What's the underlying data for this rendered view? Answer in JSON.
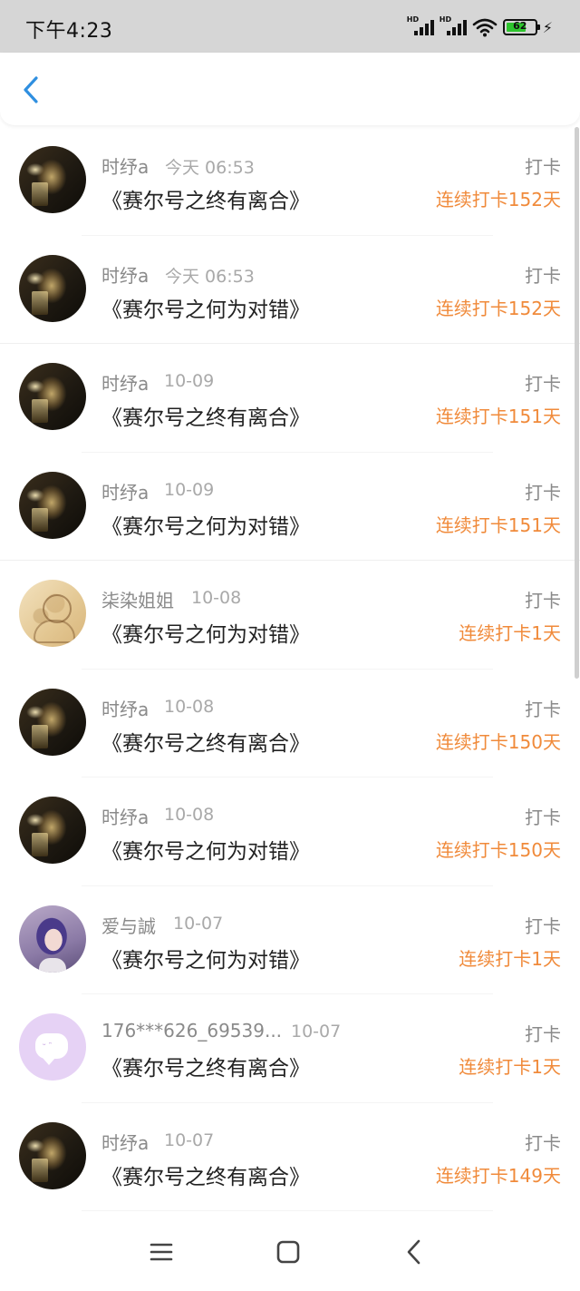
{
  "status_bar": {
    "time": "下午4:23",
    "network_label_1": "HD",
    "network_label_2": "HD",
    "battery_level": "62",
    "icons": [
      "signal-hd-icon",
      "signal-hd-icon",
      "wifi-icon",
      "battery-icon",
      "charging-bolt-icon"
    ]
  },
  "header": {
    "back_icon": "chevron-left-icon"
  },
  "records": [
    {
      "name": "时纾a",
      "time": "今天 06:53",
      "title": "《赛尔号之终有离合》",
      "action": "打卡",
      "streak": "连续打卡152天"
    },
    {
      "name": "时纾a",
      "time": "今天 06:53",
      "title": "《赛尔号之何为对错》",
      "action": "打卡",
      "streak": "连续打卡152天"
    },
    {
      "name": "时纾a",
      "time": "10-09",
      "title": "《赛尔号之终有离合》",
      "action": "打卡",
      "streak": "连续打卡151天"
    },
    {
      "name": "时纾a",
      "time": "10-09",
      "title": "《赛尔号之何为对错》",
      "action": "打卡",
      "streak": "连续打卡151天"
    },
    {
      "name": "柒染姐姐",
      "time": "10-08",
      "title": "《赛尔号之何为对错》",
      "action": "打卡",
      "streak": "连续打卡1天"
    },
    {
      "name": "时纾a",
      "time": "10-08",
      "title": "《赛尔号之终有离合》",
      "action": "打卡",
      "streak": "连续打卡150天"
    },
    {
      "name": "时纾a",
      "time": "10-08",
      "title": "《赛尔号之何为对错》",
      "action": "打卡",
      "streak": "连续打卡150天"
    },
    {
      "name": "爱与誠",
      "time": "10-07",
      "title": "《赛尔号之何为对错》",
      "action": "打卡",
      "streak": "连续打卡1天"
    },
    {
      "name": "176***626_69539...",
      "time": "10-07",
      "title": "《赛尔号之终有离合》",
      "action": "打卡",
      "streak": "连续打卡1天"
    },
    {
      "name": "时纾a",
      "time": "10-07",
      "title": "《赛尔号之终有离合》",
      "action": "打卡",
      "streak": "连续打卡149天"
    }
  ],
  "nav_bar": {
    "icons": [
      "menu-icon",
      "home-square-icon",
      "back-triangle-icon"
    ]
  },
  "colors": {
    "streak_orange": "#f08a3a",
    "back_blue": "#2f8fe0",
    "status_bar_bg": "#d6d6d6"
  }
}
